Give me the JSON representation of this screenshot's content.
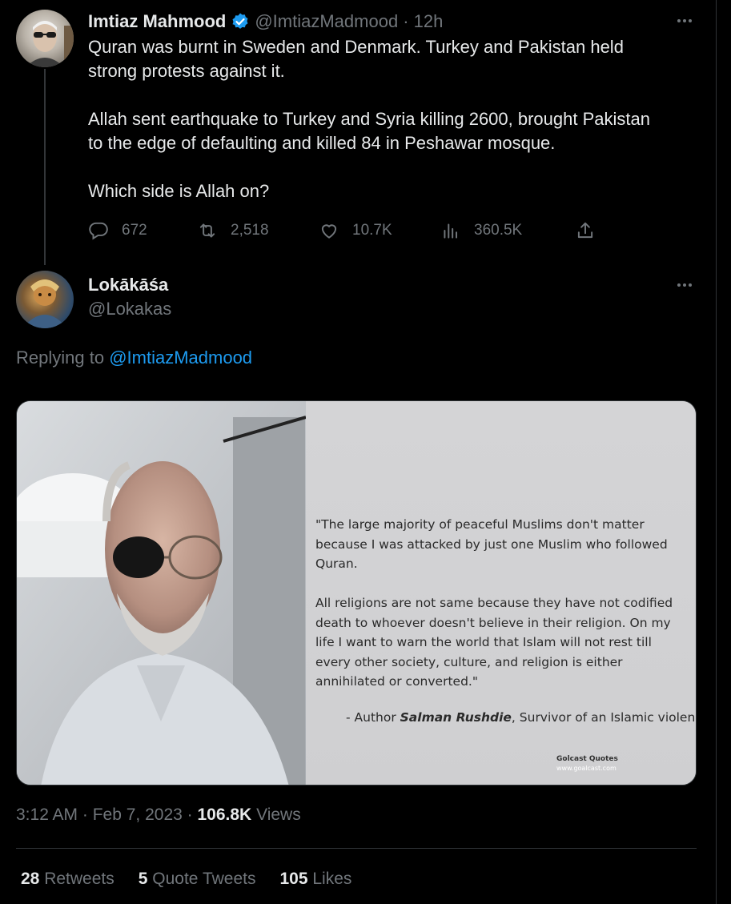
{
  "parent_tweet": {
    "author_name": "Imtiaz Mahmood",
    "handle": "@ImtiazMadmood",
    "time": "· 12h",
    "lines": [
      "Quran was burnt in Sweden and Denmark. Turkey and Pakistan held",
      "strong protests against it.",
      "",
      "Allah sent earthquake to Turkey and Syria killing 2600, brought Pakistan",
      "to the edge of defaulting and killed 84 in Peshawar mosque.",
      "",
      "Which side is Allah on?"
    ],
    "actions": {
      "replies": "672",
      "retweets": "2,518",
      "likes": "10.7K",
      "views": "360.5K"
    }
  },
  "reply_tweet": {
    "author_name": "Lokākāśa",
    "handle": "@Lokakas",
    "replying_prefix": "Replying to",
    "replying_handle": "@ImtiazMadmood",
    "image_quote": {
      "lines": [
        "\"The large majority of peaceful Muslims don't matter",
        "because I was attacked by just one Muslim who followed",
        "Quran.",
        "",
        "All religions are not same because they have not codified",
        "death to whoever doesn't believe in their religion. On my",
        "life I want to warn the world that Islam will not rest till",
        "every other society, culture, and religion is either",
        "annihilated or converted.\""
      ],
      "attribution_prefix": "- Author ",
      "attribution_name": "Salman Rushdie",
      "attribution_suffix": ", Survivor of an Islamic violence",
      "brand": "Golcast Quotes",
      "brand_url": "www.goalcast.com"
    },
    "time": "3:12 AM",
    "date": "Feb 7, 2023",
    "views_count": "106.8K",
    "views_label": "Views",
    "stats": {
      "retweets_count": "28",
      "retweets_label": "Retweets",
      "quotes_count": "5",
      "quotes_label": "Quote Tweets",
      "likes_count": "105",
      "likes_label": "Likes"
    }
  },
  "colors": {
    "background": "#000000",
    "text": "#e7e9ea",
    "secondary": "#71767b",
    "link": "#1d9bf0",
    "verified": "#1d9bf0"
  }
}
